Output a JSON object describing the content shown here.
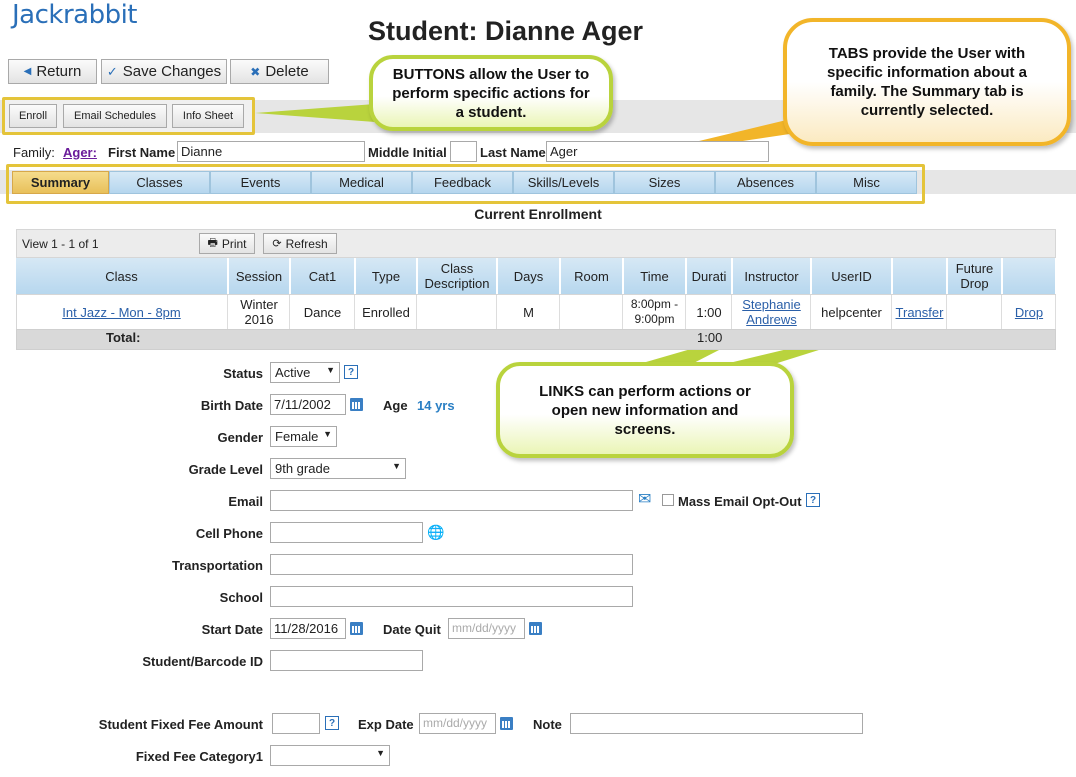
{
  "brand": {
    "logo_text": "Jackrabbit"
  },
  "page": {
    "title": "Student: Dianne Ager"
  },
  "toolbar": {
    "return_label": "Return",
    "save_label": "Save Changes",
    "delete_label": "Delete"
  },
  "actions": {
    "enroll_label": "Enroll",
    "email_schedules_label": "Email Schedules",
    "info_sheet_label": "Info Sheet"
  },
  "callouts": {
    "buttons": "BUTTONS allow the User to perform specific actions for a student.",
    "tabs": "TABS provide the User with specific information about a family. The Summary tab is currently selected.",
    "links": "LINKS can perform actions or open new information and screens."
  },
  "family_row": {
    "family_label": "Family:",
    "family_link": "Ager:",
    "first_name_label": "First Name",
    "first_name_value": "Dianne",
    "middle_initial_label": "Middle Initial",
    "middle_initial_value": "",
    "last_name_label": "Last Name",
    "last_name_value": "Ager"
  },
  "tabs": [
    "Summary",
    "Classes",
    "Events",
    "Medical",
    "Feedback",
    "Skills/Levels",
    "Sizes",
    "Absences",
    "Misc"
  ],
  "selected_tab": "Summary",
  "enrollment": {
    "title": "Current Enrollment",
    "view_text": "View 1 - 1 of 1",
    "print_label": "Print",
    "refresh_label": "Refresh",
    "columns": [
      "Class",
      "Session",
      "Cat1",
      "Type",
      "Class Description",
      "Days",
      "Room",
      "Time",
      "Durati",
      "Instructor",
      "UserID",
      "",
      "Future Drop",
      ""
    ],
    "rows": [
      {
        "class": "Int Jazz - Mon - 8pm",
        "session": "Winter 2016",
        "cat1": "Dance",
        "type": "Enrolled",
        "description": "",
        "days": "M",
        "room": "",
        "time": "8:00pm - 9:00pm",
        "duration": "1:00",
        "instructor": "Stephanie Andrews",
        "userid": "helpcenter",
        "transfer": "Transfer",
        "future_drop": "",
        "drop": "Drop"
      }
    ],
    "total_label": "Total:",
    "total_duration": "1:00"
  },
  "form": {
    "status_label": "Status",
    "status_value": "Active",
    "birth_date_label": "Birth Date",
    "birth_date_value": "7/11/2002",
    "age_label": "Age",
    "age_value": "14 yrs",
    "gender_label": "Gender",
    "gender_value": "Female",
    "grade_label": "Grade Level",
    "grade_value": "9th grade",
    "email_label": "Email",
    "email_value": "",
    "mass_email_label": "Mass Email Opt-Out",
    "cell_phone_label": "Cell Phone",
    "cell_phone_value": "",
    "transportation_label": "Transportation",
    "school_label": "School",
    "start_date_label": "Start Date",
    "start_date_value": "11/28/2016",
    "date_quit_label": "Date Quit",
    "date_placeholder": "mm/dd/yyyy",
    "barcode_label": "Student/Barcode ID",
    "fixed_fee_label": "Student Fixed Fee Amount",
    "exp_date_label": "Exp Date",
    "note_label": "Note",
    "fee_category_label": "Fixed Fee Category1",
    "fee_category_value": ""
  }
}
